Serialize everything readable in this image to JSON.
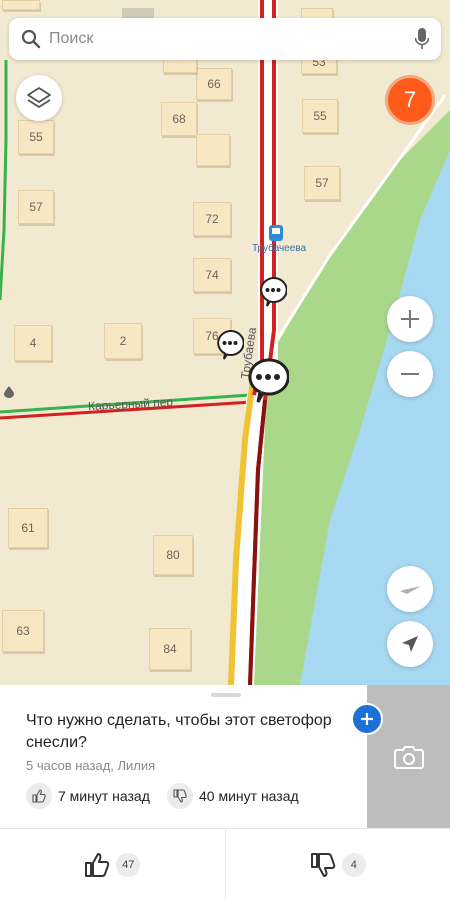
{
  "search": {
    "placeholder": "Поиск"
  },
  "map": {
    "street_label": "Карьерный пер",
    "road_label": "Трубаева",
    "stop_label": "Трубачеева",
    "house_numbers": [
      "55",
      "57",
      "4",
      "2",
      "76",
      "74",
      "72",
      "68",
      "66",
      "53",
      "55",
      "57",
      "61",
      "80",
      "63",
      "84"
    ],
    "traffic_level": "7",
    "accent_colors": {
      "traffic_badge": "#ff5a1a",
      "jam_red": "#d32020",
      "river": "#a6d8f2",
      "park": "#a9d88b"
    }
  },
  "card": {
    "question": "Что нужно сделать, чтобы этот светофор снесли?",
    "meta": "5 часов назад, Лилия",
    "like_time": "7 минут назад",
    "dislike_time": "40 минут назад",
    "likes": "47",
    "dislikes": "4"
  }
}
